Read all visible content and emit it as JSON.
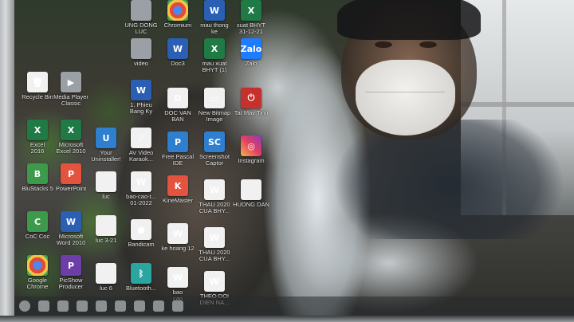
{
  "desktop": {
    "icons": [
      {
        "label": "UNG DONG\nLUC",
        "icon": "folder-icon",
        "style": "t-gray",
        "glyph": ""
      },
      {
        "label": "Chromium",
        "icon": "chromium-icon",
        "style": "t-chrome",
        "glyph": ""
      },
      {
        "label": "mau thong\nke",
        "icon": "word-doc-icon",
        "style": "t-word",
        "glyph": "W"
      },
      {
        "label": "xuat BHYT\n31-12-21",
        "icon": "excel-icon",
        "style": "t-excel",
        "glyph": "X"
      },
      {
        "label": "video",
        "icon": "video-icon",
        "style": "t-gray",
        "glyph": ""
      },
      {
        "label": "Doc3",
        "icon": "word-doc-icon",
        "style": "t-word",
        "glyph": "W"
      },
      {
        "label": "mau xuat\nBHYT (1)",
        "icon": "excel-icon",
        "style": "t-excel",
        "glyph": "X"
      },
      {
        "label": "Zalo",
        "icon": "zalo-icon",
        "style": "t-zalo",
        "glyph": "Zalo"
      },
      {
        "label": "Recycle Bin",
        "icon": "recycle-bin-icon",
        "style": "t-white",
        "glyph": "🗑"
      },
      {
        "label": "Media Player\nClassic",
        "icon": "media-player-icon",
        "style": "t-gray",
        "glyph": "▶"
      },
      {
        "label": "1. Phieu\nBang Ky",
        "icon": "word-doc-icon",
        "style": "t-word",
        "glyph": "W"
      },
      {
        "label": "DOC VAN\nBAN",
        "icon": "word-doc-icon",
        "style": "t-white",
        "glyph": "D"
      },
      {
        "label": "New Bitmap\nImage",
        "icon": "bitmap-icon",
        "style": "t-white",
        "glyph": "▭"
      },
      {
        "label": "Tat May Tinh",
        "icon": "power-icon",
        "style": "t-pdf",
        "glyph": "⏻"
      },
      {
        "label": "Excel\n2016",
        "icon": "excel-icon",
        "style": "t-excel",
        "glyph": "X"
      },
      {
        "label": "Microsoft\nExcel 2010",
        "icon": "excel-icon",
        "style": "t-excel",
        "glyph": "X"
      },
      {
        "label": "Your\nUninstaller!",
        "icon": "uninstaller-icon",
        "style": "t-blue",
        "glyph": "U"
      },
      {
        "label": "AV Video\nKaraok...",
        "icon": "karaoke-icon",
        "style": "t-white",
        "glyph": "♪"
      },
      {
        "label": "Free Pascal\nIDE",
        "icon": "pascal-icon",
        "style": "t-blue",
        "glyph": "P"
      },
      {
        "label": "Screenshot\nCaptor",
        "icon": "screenshot-icon",
        "style": "t-blue",
        "glyph": "SC"
      },
      {
        "label": "Instagram",
        "icon": "instagram-icon",
        "style": "t-insta",
        "glyph": "◎"
      },
      {
        "label": "BluStacks 5",
        "icon": "bluestacks-icon",
        "style": "t-green",
        "glyph": "B"
      },
      {
        "label": "PowerPoint",
        "icon": "powerpoint-icon",
        "style": "t-red2",
        "glyph": "P"
      },
      {
        "label": "luc",
        "icon": "file-icon",
        "style": "t-white",
        "glyph": ""
      },
      {
        "label": "bao-cao-t...\n01-2022",
        "icon": "word-doc-icon",
        "style": "t-white",
        "glyph": "W"
      },
      {
        "label": "KineMaster",
        "icon": "kinemaster-icon",
        "style": "t-red2",
        "glyph": "K"
      },
      {
        "label": "THAU 2020\nCUA BHY...",
        "icon": "word-doc-icon",
        "style": "t-white",
        "glyph": "W"
      },
      {
        "label": "HUONG DAN",
        "icon": "file-icon",
        "style": "t-white",
        "glyph": ""
      },
      {
        "label": "CoC Coc",
        "icon": "coccoc-icon",
        "style": "t-green",
        "glyph": "C"
      },
      {
        "label": "Microsoft\nWord 2010",
        "icon": "word-icon",
        "style": "t-word",
        "glyph": "W"
      },
      {
        "label": "luc 3-21",
        "icon": "file-icon",
        "style": "t-white",
        "glyph": ""
      },
      {
        "label": "Bandicam",
        "icon": "bandicam-icon",
        "style": "t-white",
        "glyph": "●"
      },
      {
        "label": "ke hoang 12",
        "icon": "word-doc-icon",
        "style": "t-white",
        "glyph": "W"
      },
      {
        "label": "THAU 2020\nCUA BHY...",
        "icon": "word-doc-icon",
        "style": "t-white",
        "glyph": "W"
      },
      {
        "label": "Google\nChrome",
        "icon": "chrome-icon",
        "style": "t-chrome",
        "glyph": ""
      },
      {
        "label": "PicShow\nProducer",
        "icon": "picshow-icon",
        "style": "t-purple",
        "glyph": "P"
      },
      {
        "label": "luc 6",
        "icon": "file-icon",
        "style": "t-white",
        "glyph": ""
      },
      {
        "label": "Bluetooth...",
        "icon": "bluetooth-icon",
        "style": "t-teal",
        "glyph": "ᛒ"
      },
      {
        "label": "bao\ncao",
        "icon": "word-doc-icon",
        "style": "t-white",
        "glyph": "W"
      },
      {
        "label": "THEO DOI\nDIEN NA...",
        "icon": "word-doc-icon",
        "style": "t-white",
        "glyph": "W"
      }
    ]
  },
  "taskbar": {
    "buttons": [
      "start",
      "app1",
      "app2",
      "app3",
      "app4",
      "app5",
      "app6",
      "app7",
      "app8"
    ]
  }
}
